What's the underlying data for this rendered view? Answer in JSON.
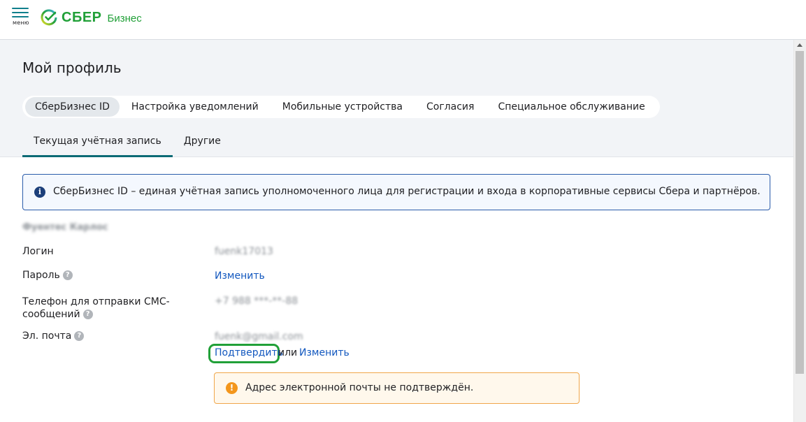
{
  "header": {
    "menu_label": "меню",
    "logo_text": "СБЕР",
    "logo_sub": "Бизнес",
    "brand_color": "#21a038"
  },
  "page": {
    "title": "Мой профиль"
  },
  "pill_tabs": [
    {
      "label": "СберБизнес ID",
      "active": true
    },
    {
      "label": "Настройка уведомлений",
      "active": false
    },
    {
      "label": "Мобильные устройства",
      "active": false
    },
    {
      "label": "Согласия",
      "active": false
    },
    {
      "label": "Специальное обслуживание",
      "active": false
    }
  ],
  "sub_tabs": [
    {
      "label": "Текущая учётная запись",
      "active": true
    },
    {
      "label": "Другие",
      "active": false
    }
  ],
  "info_banner": {
    "icon": "info-icon",
    "text": "СберБизнес ID – единая учётная запись уполномоченного лица для регистрации и входа в корпоративные сервисы Сбера и партнёров."
  },
  "profile": {
    "name": "Фуентес Карлос",
    "login_label": "Логин",
    "login_value": "fuenk17013",
    "password_label": "Пароль",
    "password_action": "Изменить",
    "phone_label_line1": "Телефон для отправки СМС-",
    "phone_label_line2": "сообщений",
    "phone_value": "+7 988 ***-**-88",
    "email_label": "Эл. почта",
    "email_value": "fuenk@gmail.com",
    "email_confirm": "Подтвердить",
    "email_or": "или",
    "email_change": "Изменить"
  },
  "warning_banner": {
    "icon": "warning-icon",
    "text": "Адрес электронной почты не подтверждён."
  }
}
